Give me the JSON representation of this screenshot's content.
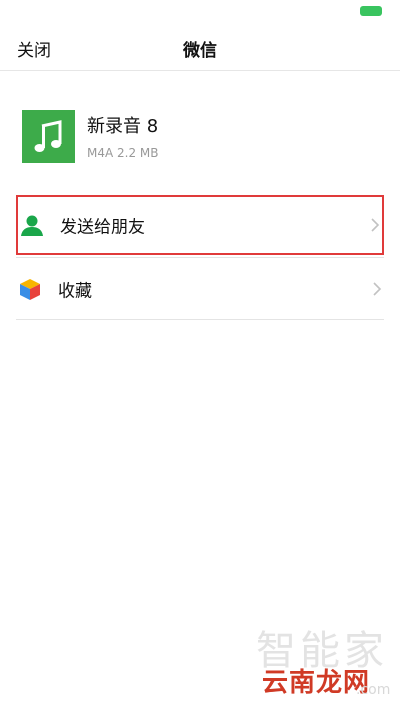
{
  "nav": {
    "close_label": "关闭",
    "title": "微信"
  },
  "file": {
    "name": "新录音 8",
    "meta": "M4A 2.2 MB",
    "thumb_color": "#3dab4a"
  },
  "menu": {
    "send": {
      "label": "发送给朋友",
      "icon": "contact-person-icon",
      "highlight_color": "#e03a3a"
    },
    "favorite": {
      "label": "收藏",
      "icon": "favorites-cube-icon"
    }
  },
  "watermark": {
    "top_text": "智能家",
    "main_text": "云南龙网",
    "sub_text": ".com"
  },
  "colors": {
    "accent_green": "#39c45f"
  }
}
